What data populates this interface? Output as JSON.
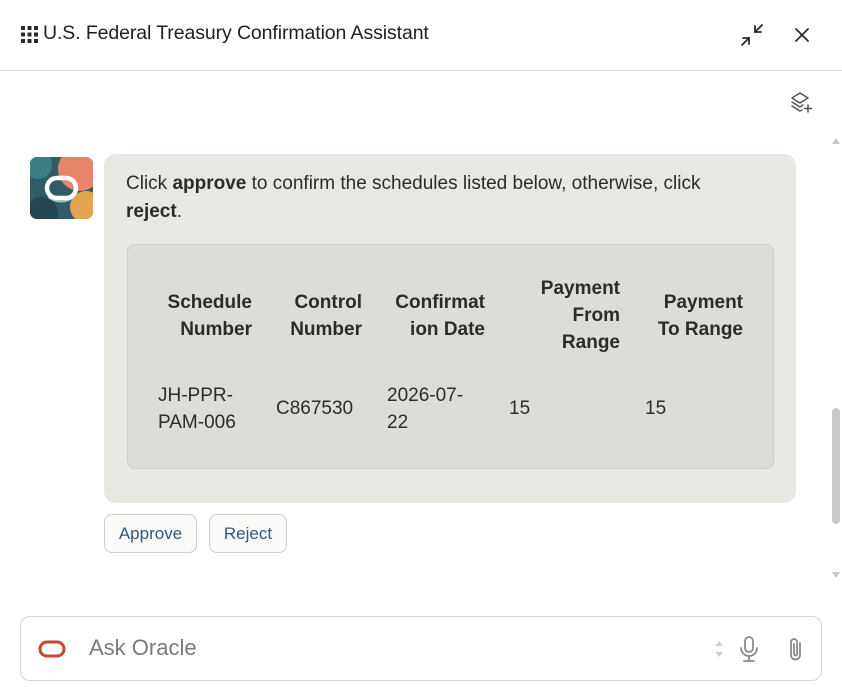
{
  "header": {
    "title": "U.S. Federal Treasury Confirmation Assistant",
    "icons": {
      "menu": "grid-icon",
      "minimize": "minimize-icon",
      "close": "close-icon",
      "layers": "layers-add-icon"
    }
  },
  "message": {
    "intro_prefix": "Click ",
    "approve_word": "approve",
    "intro_middle": " to confirm the schedules listed below, otherwise, click",
    "reject_word": "reject",
    "intro_suffix": ".",
    "table": {
      "headers": {
        "schedule_number": [
          "Schedule",
          "Number"
        ],
        "control_number": [
          "Control",
          "Number"
        ],
        "confirmation_date": [
          "Confirmat",
          "ion Date"
        ],
        "payment_from_range": [
          "Payment",
          "From",
          "Range"
        ],
        "payment_to_range": [
          "Payment",
          "To Range"
        ]
      },
      "rows": [
        {
          "schedule_number": [
            "JH-PPR-",
            "PAM-006"
          ],
          "control_number": "C867530",
          "confirmation_date": [
            "2026-07-",
            "22"
          ],
          "payment_from_range": "15",
          "payment_to_range": "15"
        }
      ]
    }
  },
  "actions": {
    "approve_label": "Approve",
    "reject_label": "Reject"
  },
  "composer": {
    "placeholder": "Ask Oracle"
  },
  "colors": {
    "accent_link": "#2e5a7a",
    "oracle_red": "#c74634",
    "bubble_bg": "#e9e7e2"
  }
}
